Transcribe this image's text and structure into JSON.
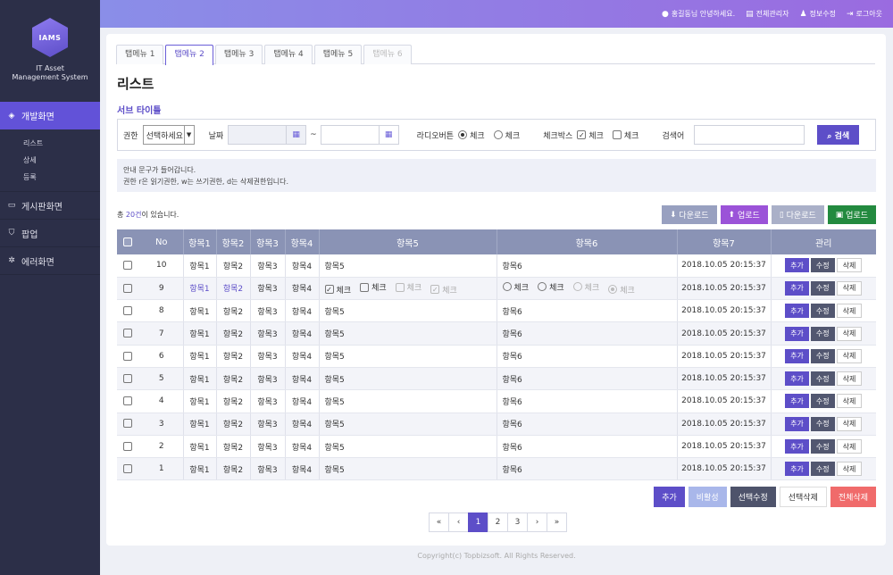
{
  "brand": {
    "logo_text": "IAMS",
    "line1": "IT Asset",
    "line2": "Management System"
  },
  "sidebar": {
    "items": [
      {
        "label": "개발화면",
        "icon": "diamond-icon"
      },
      {
        "label": "게시판화면",
        "icon": "monitor-icon"
      },
      {
        "label": "팝업",
        "icon": "shield-icon"
      },
      {
        "label": "에러화면",
        "icon": "gear-icon"
      }
    ],
    "subitems": [
      "리스트",
      "상세",
      "등록"
    ]
  },
  "topbar": {
    "greeting": "홍길동님 안녕하세요.",
    "admin": "전체관리자",
    "profile": "정보수정",
    "logout": "로그아웃"
  },
  "tabs": [
    "탭메뉴 1",
    "탭메뉴 2",
    "탭메뉴 3",
    "탭메뉴 4",
    "탭메뉴 5",
    "탭메뉴 6"
  ],
  "page": {
    "title": "리스트",
    "subtitle": "서브 타이틀"
  },
  "search": {
    "perm_label": "권한",
    "perm_value": "선택하세요",
    "date_label": "날짜",
    "tilde": "~",
    "radio_label": "라디오버튼",
    "radio_opt1": "체크",
    "radio_opt2": "체크",
    "check_label": "체크박스",
    "check_opt1": "체크",
    "check_opt2": "체크",
    "keyword_label": "검색어",
    "button": "검색"
  },
  "info": {
    "line1": "안내 문구가 들어갑니다.",
    "line2": "권한 r은 읽기권한, w는 쓰기권한, d는 삭제권한입니다."
  },
  "count": {
    "prefix": "총 ",
    "num": "20건",
    "suffix": "이 있습니다."
  },
  "top_buttons": [
    "다운로드",
    "업로드",
    "다운로드",
    "업로드"
  ],
  "table": {
    "headers": [
      "No",
      "항목1",
      "항목2",
      "항목3",
      "항목4",
      "항목5",
      "항목6",
      "항목7",
      "관리"
    ],
    "rows": [
      {
        "no": "10",
        "c1": "항목1",
        "c2": "항목2",
        "c3": "항목3",
        "c4": "항목4",
        "c5": "항목5",
        "c6": "항목6",
        "c7": "2018.10.05 20:15:37"
      },
      {
        "no": "9",
        "c1": "항목1",
        "c2": "항목2",
        "c3": "항목3",
        "c4": "항목4",
        "c5": "",
        "c6": "",
        "c7": "2018.10.05 20:15:37"
      },
      {
        "no": "8",
        "c1": "항목1",
        "c2": "항목2",
        "c3": "항목3",
        "c4": "항목4",
        "c5": "항목5",
        "c6": "항목6",
        "c7": "2018.10.05 20:15:37"
      },
      {
        "no": "7",
        "c1": "항목1",
        "c2": "항목2",
        "c3": "항목3",
        "c4": "항목4",
        "c5": "항목5",
        "c6": "항목6",
        "c7": "2018.10.05 20:15:37"
      },
      {
        "no": "6",
        "c1": "항목1",
        "c2": "항목2",
        "c3": "항목3",
        "c4": "항목4",
        "c5": "항목5",
        "c6": "항목6",
        "c7": "2018.10.05 20:15:37"
      },
      {
        "no": "5",
        "c1": "항목1",
        "c2": "항목2",
        "c3": "항목3",
        "c4": "항목4",
        "c5": "항목5",
        "c6": "항목6",
        "c7": "2018.10.05 20:15:37"
      },
      {
        "no": "4",
        "c1": "항목1",
        "c2": "항목2",
        "c3": "항목3",
        "c4": "항목4",
        "c5": "항목5",
        "c6": "항목6",
        "c7": "2018.10.05 20:15:37"
      },
      {
        "no": "3",
        "c1": "항목1",
        "c2": "항목2",
        "c3": "항목3",
        "c4": "항목4",
        "c5": "항목5",
        "c6": "항목6",
        "c7": "2018.10.05 20:15:37"
      },
      {
        "no": "2",
        "c1": "항목1",
        "c2": "항목2",
        "c3": "항목3",
        "c4": "항목4",
        "c5": "항목5",
        "c6": "항목6",
        "c7": "2018.10.05 20:15:37"
      },
      {
        "no": "1",
        "c1": "항목1",
        "c2": "항목2",
        "c3": "항목3",
        "c4": "항목4",
        "c5": "항목5",
        "c6": "항목6",
        "c7": "2018.10.05 20:15:37"
      }
    ],
    "row_check_label": "체크",
    "row_add": "추가",
    "row_edit": "수정",
    "row_delete": "삭제"
  },
  "bottom_buttons": {
    "add": "추가",
    "private": "비활성",
    "sel_edit": "선택수정",
    "sel_delete": "선택삭제",
    "all_delete": "전체삭제"
  },
  "pager": {
    "first": "«",
    "prev": "‹",
    "pages": [
      "1",
      "2",
      "3"
    ],
    "next": "›",
    "last": "»"
  },
  "footer": "Copyright(c) Topbizsoft. All Rights Reserved.",
  "colors": {
    "accent": "#5d4ec8",
    "sidebar": "#2c2f48",
    "table_header": "#8a93b5",
    "danger": "#f06b6b",
    "success": "#238a3f"
  }
}
